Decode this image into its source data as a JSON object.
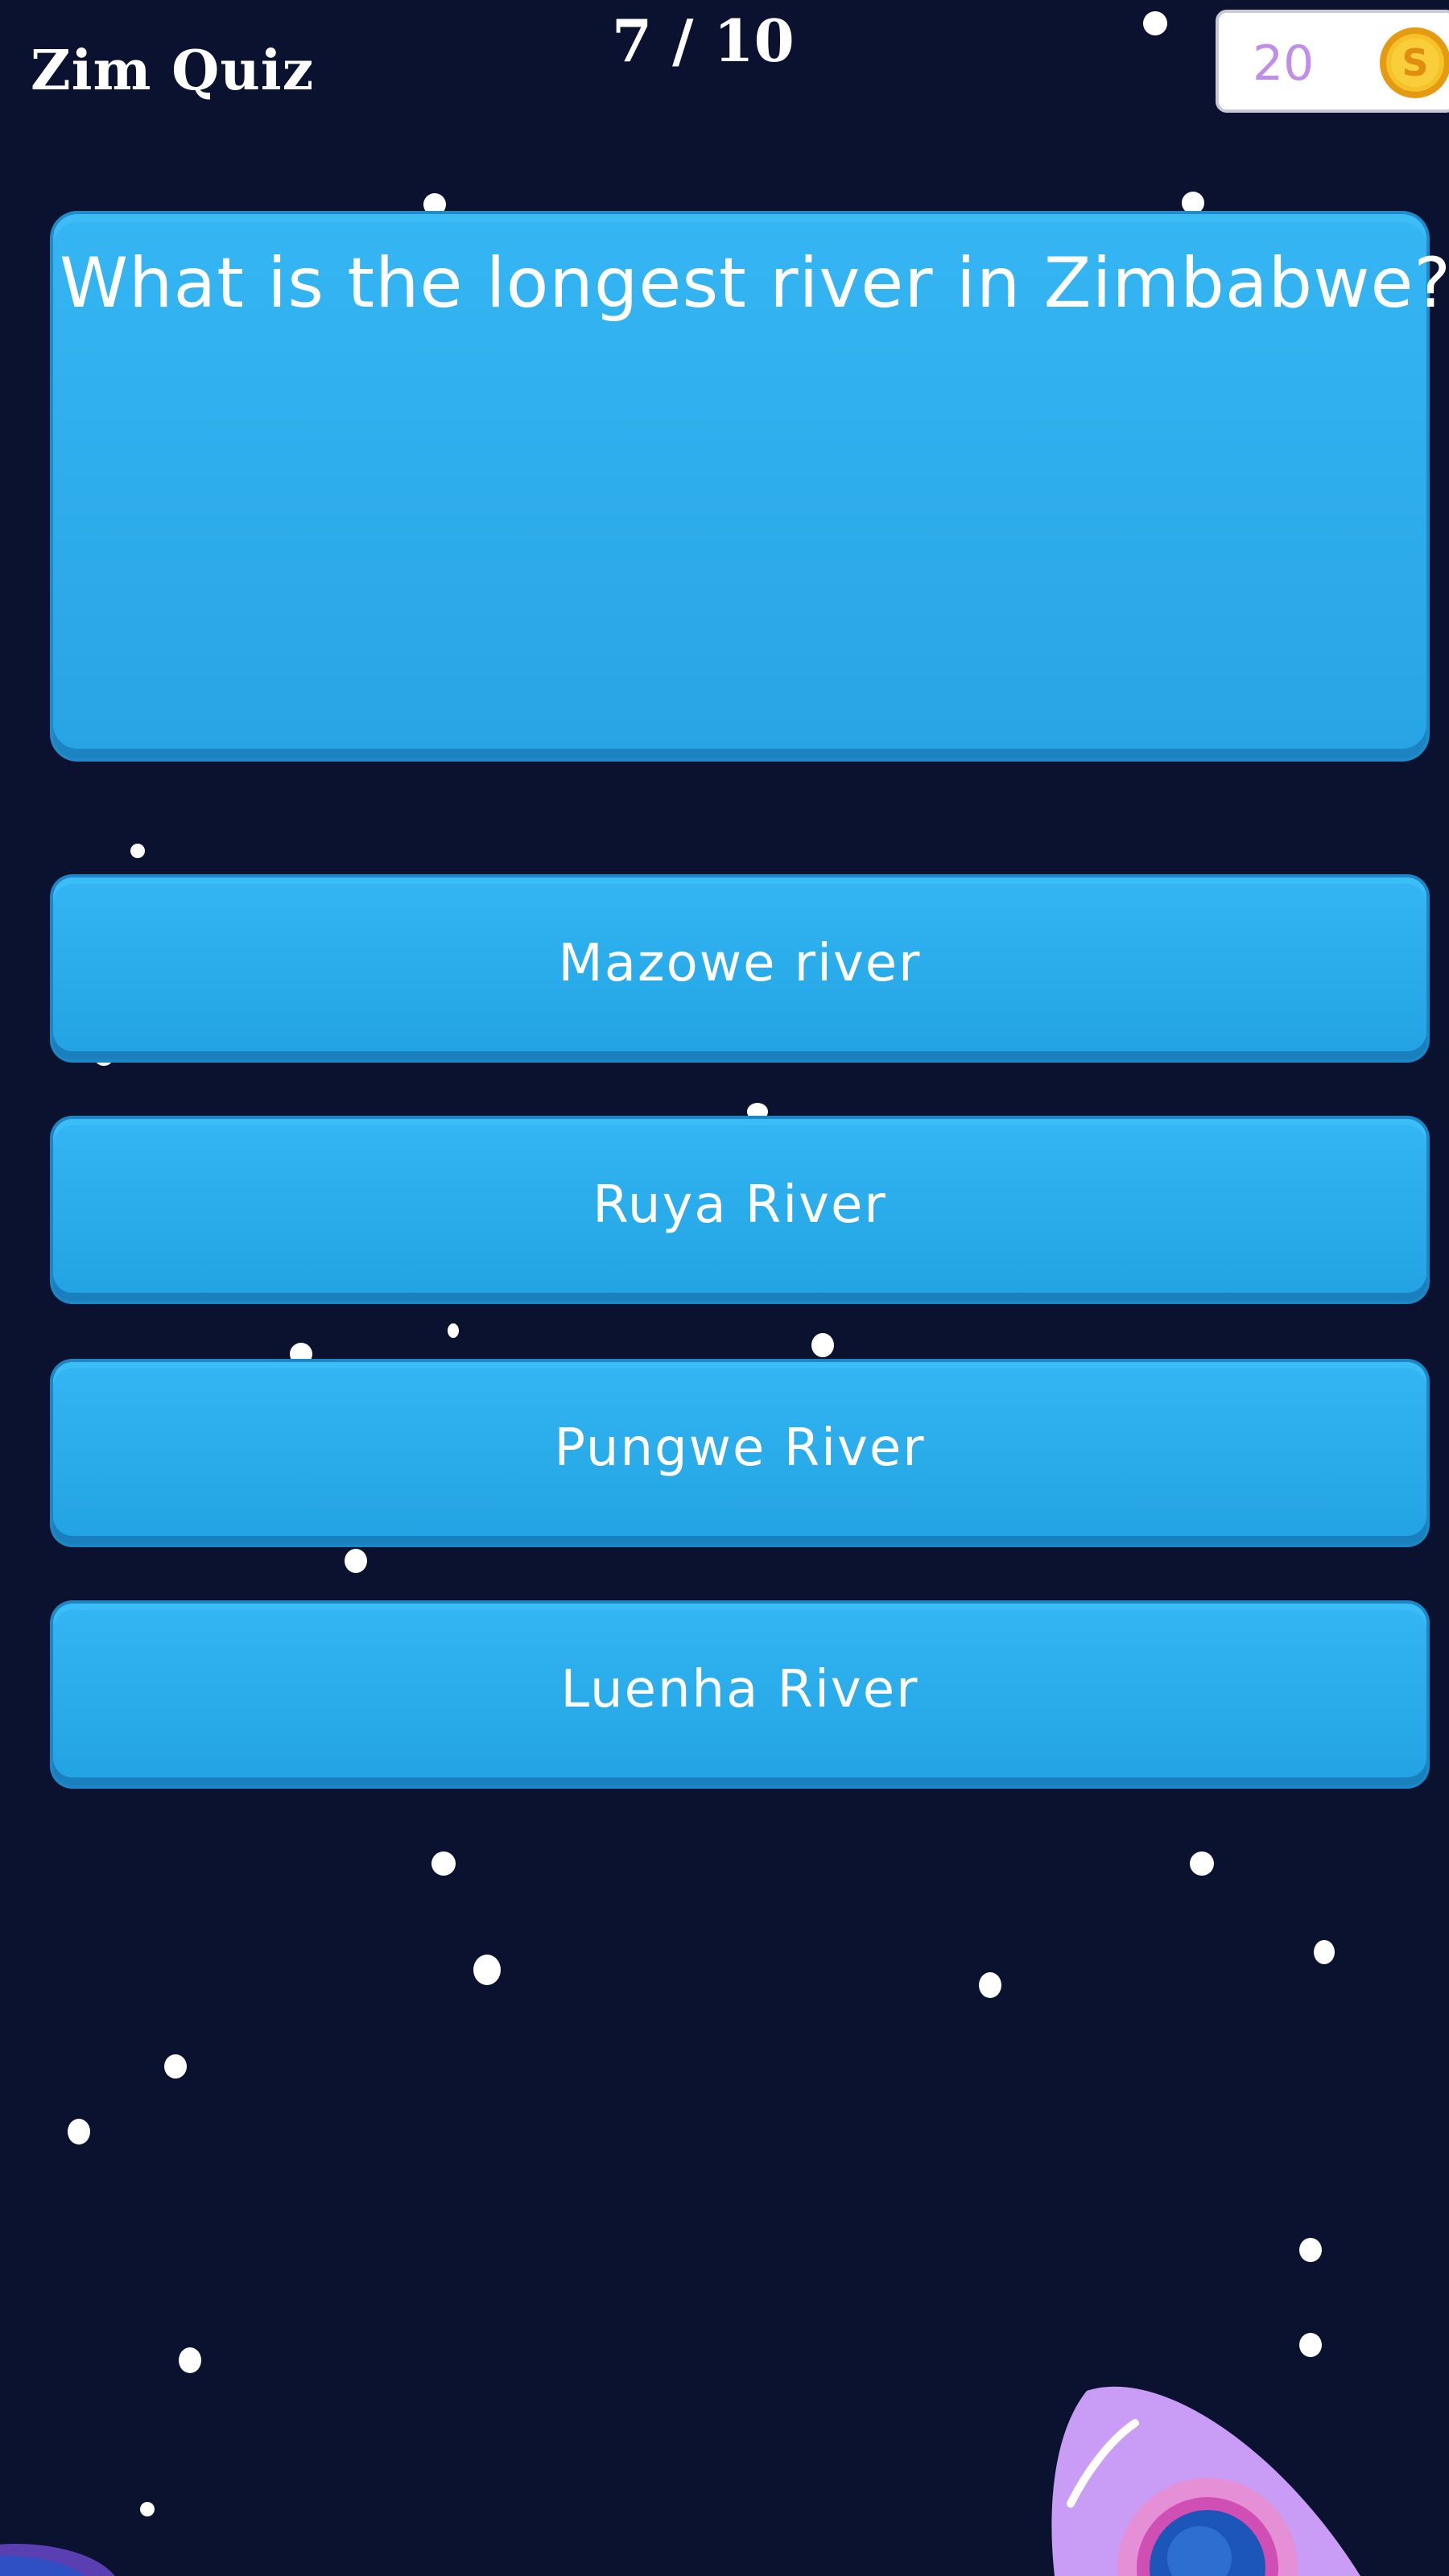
{
  "header": {
    "app_title": "Zim Quiz",
    "progress": "7 / 10",
    "coins": "20",
    "coin_symbol": "S"
  },
  "question": {
    "text": "What is the longest river in Zimbabwe?"
  },
  "answers": [
    {
      "label": "Mazowe river"
    },
    {
      "label": "Ruya River"
    },
    {
      "label": "Pungwe River"
    },
    {
      "label": "Luenha River"
    }
  ],
  "colors": {
    "background": "#0b1230",
    "card": "#2fb0ef",
    "coin_text": "#c08ee8",
    "coin_gold": "#f2b81c",
    "rocket_body": "#c99cf6"
  }
}
